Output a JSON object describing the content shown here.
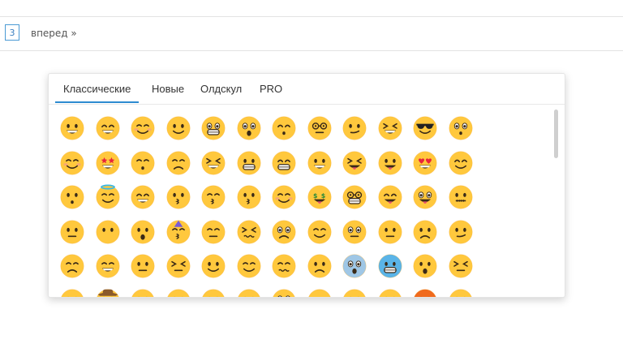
{
  "pagination": {
    "page": "3",
    "next": "вперед »"
  },
  "picker": {
    "tabs": [
      {
        "label": "Классические",
        "active": true
      },
      {
        "label": "Новые",
        "active": false
      },
      {
        "label": "Олдскул",
        "active": false
      },
      {
        "label": "PRO",
        "active": false
      }
    ],
    "rows": [
      [
        "grin",
        "laugh",
        "blush",
        "smile",
        "grimace",
        "astonished",
        "hand-mouth",
        "monocle",
        "thinking",
        "zany-laugh",
        "sunglasses",
        "flushed"
      ],
      [
        "smile-blush",
        "star-eyes",
        "sleepy",
        "sad-sweat",
        "squint-grin",
        "grin-teeth",
        "beam",
        "big-grin",
        "tongue-wink",
        "tongue",
        "heart-eyes",
        "hug"
      ],
      [
        "hushed",
        "halo",
        "joy-tears",
        "kiss",
        "kiss-smile",
        "kiss-heart",
        "relieved",
        "money",
        "nerd",
        "yum",
        "crazy",
        "zipper"
      ],
      [
        "neutral",
        "no-mouth",
        "open-mouth",
        "party",
        "pensive",
        "confounded",
        "pleading",
        "content",
        "rolling-eyes",
        "shush",
        "worried",
        "smirk"
      ],
      [
        "downcast-sweat",
        "cold-sweat",
        "thermometer",
        "steam",
        "upside-down",
        "love",
        "woozy",
        "slight-frown",
        "scream",
        "cold",
        "anxious",
        "persevere"
      ],
      [
        "face-a",
        "cowboy",
        "face-b",
        "face-c",
        "face-d",
        "face-e",
        "face-f",
        "face-g",
        "face-h",
        "face-i",
        "angry",
        "face-j"
      ]
    ]
  },
  "colors": {
    "face": "#FFC83D",
    "face_dark": "#F5A623",
    "feature": "#3a2a17",
    "accent": "#2d8bd0"
  }
}
